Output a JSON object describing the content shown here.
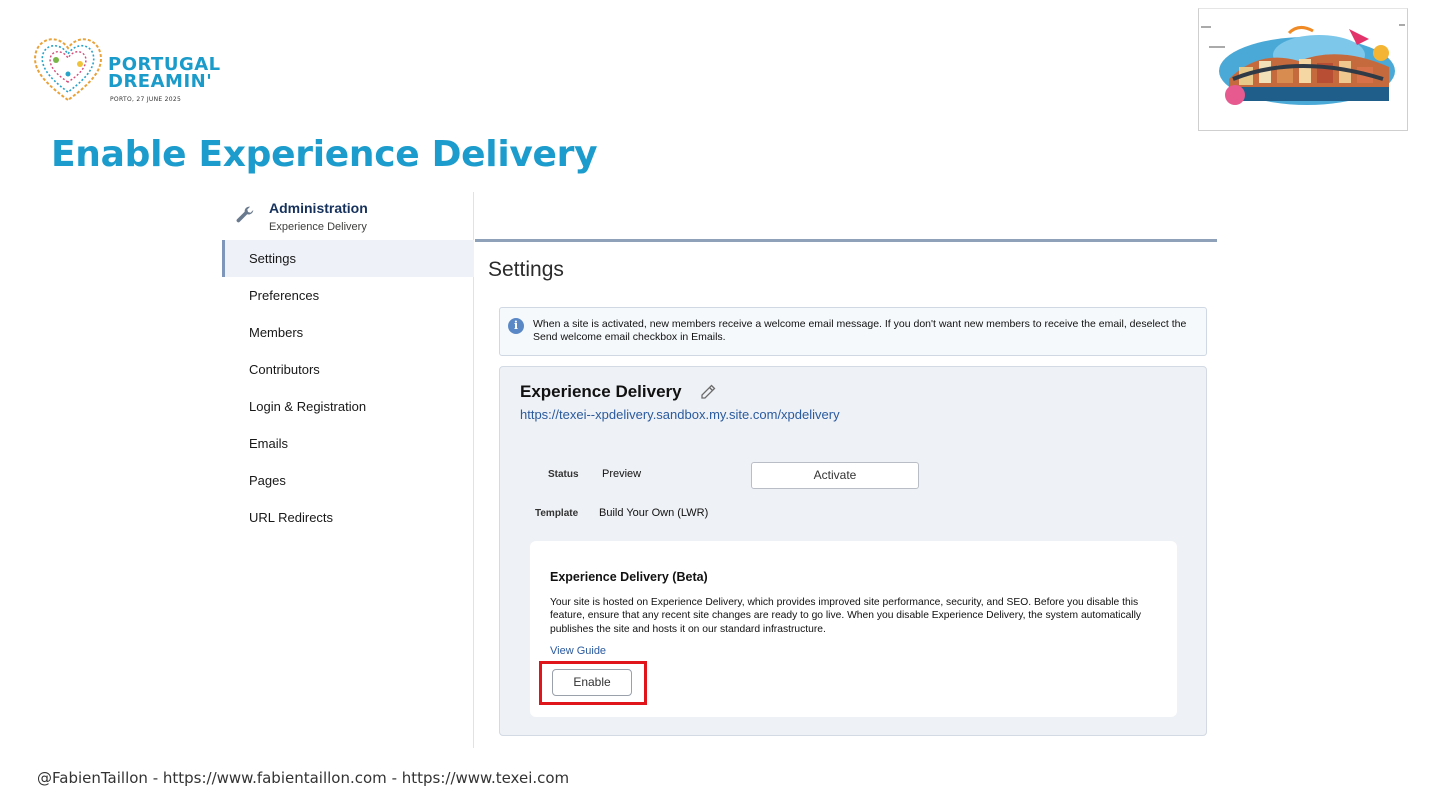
{
  "branding": {
    "logo_line1": "PORTUGAL",
    "logo_line2": "DREAMIN'",
    "logo_date": "PORTO, 27 JUNE 2025"
  },
  "slide": {
    "title": "Enable Experience Delivery",
    "footer": "@FabienTaillon - https://www.fabientaillon.com - https://www.texei.com"
  },
  "sidebar": {
    "header_title": "Administration",
    "header_subtitle": "Experience Delivery",
    "items": [
      {
        "label": "Settings",
        "active": true
      },
      {
        "label": "Preferences"
      },
      {
        "label": "Members"
      },
      {
        "label": "Contributors"
      },
      {
        "label": "Login & Registration"
      },
      {
        "label": "Emails"
      },
      {
        "label": "Pages"
      },
      {
        "label": "URL Redirects"
      }
    ]
  },
  "main": {
    "heading": "Settings",
    "info_message": "When a site is activated, new members receive a welcome email message. If you don't want new members to receive the email, deselect the Send welcome email checkbox in Emails.",
    "site": {
      "name": "Experience Delivery",
      "url": "https://texei--xpdelivery.sandbox.my.site.com/xpdelivery",
      "status_label": "Status",
      "status_value": "Preview",
      "activate_label": "Activate",
      "template_label": "Template",
      "template_value": "Build Your Own (LWR)"
    },
    "beta": {
      "title": "Experience Delivery (Beta)",
      "description": "Your site is hosted on Experience Delivery, which provides improved site performance, security, and SEO. Before you disable this feature, ensure that any recent site changes are ready to go live. When you disable Experience Delivery, the system automatically publishes the site and hosts it on our standard infrastructure.",
      "link_label": "View Guide",
      "button_label": "Enable"
    }
  },
  "colors": {
    "title_blue": "#1b9ccc",
    "link_blue": "#2a5a9f",
    "highlight_red": "#e0151b",
    "nav_active_bg": "#eef1f8",
    "card_bg": "#eef1f5"
  },
  "icons": {
    "admin": "wrench-icon",
    "edit": "pencil-icon",
    "info": "info-icon"
  }
}
